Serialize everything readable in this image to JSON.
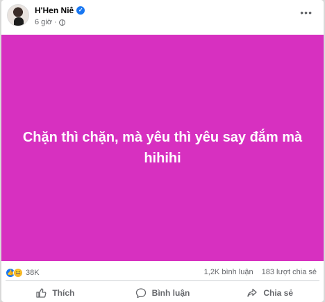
{
  "post": {
    "author": "H'Hen Niê",
    "time": "6 giờ",
    "text": "Chặn thì chặn, mà yêu thì yêu say đắm mà hihihi",
    "background_color": "#d730c0",
    "more_icon": "more-options-icon"
  },
  "stats": {
    "reaction_count": "38K",
    "comments": "1,2K bình luận",
    "shares": "183 lượt chia sẻ",
    "reaction_icons": [
      "like-reaction-icon",
      "haha-reaction-icon"
    ]
  },
  "actions": {
    "like_label": "Thích",
    "comment_label": "Bình luận",
    "share_label": "Chia sẻ"
  }
}
